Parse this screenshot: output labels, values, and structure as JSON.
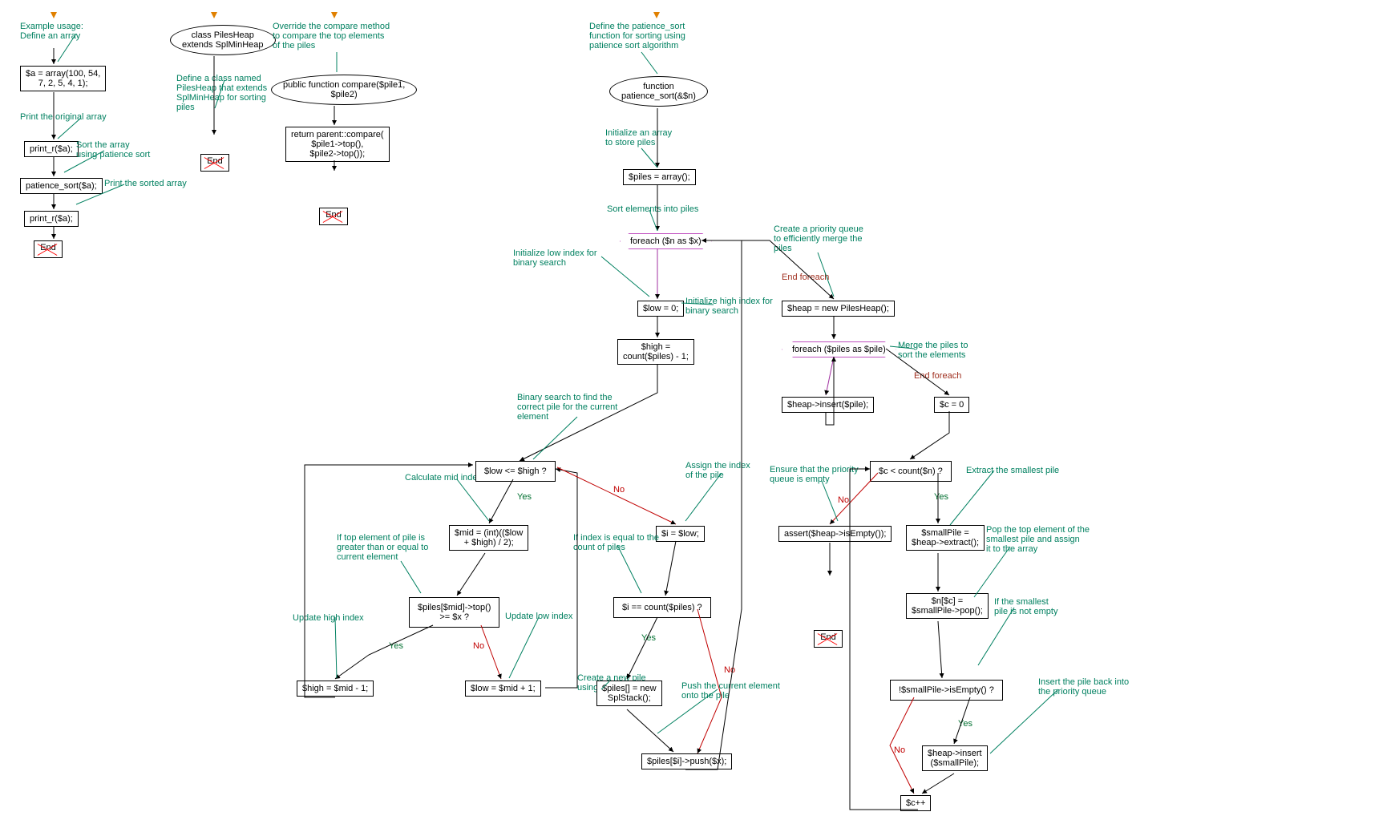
{
  "col1": {
    "ann1": "Example usage:\nDefine an array",
    "n1": "$a = array(100, 54,\n7, 2, 5, 4, 1);",
    "ann2": "Print the original array",
    "n2": "print_r($a);",
    "ann3": "Sort the array\nusing patience sort",
    "n3": "patience_sort($a);",
    "ann4": "Print the sorted array",
    "n4": "print_r($a);",
    "end": "End"
  },
  "col2": {
    "n1": "class PilesHeap\nextends SplMinHeap",
    "ann1": "Define a class named\nPilesHeap that extends\nSplMinHeap for sorting\npiles",
    "end": "End"
  },
  "col3": {
    "ann1": "Override the compare method\nto compare the top elements\nof the piles",
    "n1": "public function compare($pile1,\n$pile2)",
    "n2": "return parent::compare(\n$pile1->top(),\n$pile2->top());",
    "end": "End"
  },
  "main": {
    "ann_top": "Define the patience_sort\nfunction for sorting using\npatience sort algorithm",
    "fn": "function\npatience_sort(&$n)",
    "ann_init": "Initialize an array\nto store piles",
    "piles": "$piles = array();",
    "ann_sort": "Sort elements into piles",
    "foreach1": "foreach ($n as $x)",
    "ann_low": "Initialize low index for\nbinary search",
    "low": "$low = 0;",
    "ann_high": "Initialize high index for\nbinary search",
    "high": "$high =\ncount($piles) - 1;",
    "ann_bin": "Binary search to find the\ncorrect pile for the current\nelement",
    "cond_lowhigh": "$low <= $high ?",
    "ann_calcmid": "Calculate mid index",
    "mid": "$mid = (int)(($low\n+ $high) / 2);",
    "ann_iftop": "If top element of pile is\ngreater than or equal to\ncurrent element",
    "cond_top": "$piles[$mid]->top()\n>= $x ?",
    "ann_uphigh": "Update high index",
    "sethigh": "$high = $mid - 1;",
    "ann_uplow": "Update low index",
    "setlow": "$low = $mid + 1;",
    "ann_assignidx": "Assign the index\nof the pile",
    "ilow": "$i = $low;",
    "ann_ifidx": "If index is equal to the\ncount of piles",
    "cond_i": "$i == count($piles) ?",
    "ann_newpile": "Create a new pile\nusing SplStack",
    "newstack": "$piles[] = new\nSplStack();",
    "ann_push": "Push the current element\nonto the pile",
    "push": "$piles[$i]->push($x);",
    "ann_heap": "Create a priority queue\nto efficiently merge the\npiles",
    "endforeach1": "End foreach",
    "heap": "$heap = new PilesHeap();",
    "foreach2": "foreach ($piles as $pile)",
    "ann_merge": "Merge the piles to\nsort the elements",
    "endforeach2": "End foreach",
    "insert": "$heap->insert($pile);",
    "czero": "$c = 0",
    "cond_c": "$c < count($n) ?",
    "ann_ensure": "Ensure that the priority\nqueue is empty",
    "assert": "assert($heap->isEmpty());",
    "end": "End",
    "ann_extract": "Extract the smallest pile",
    "extract": "$smallPile =\n$heap->extract();",
    "ann_pop": "Pop the top element of the\nsmallest pile and assign\nit to the array",
    "pop": "$n[$c] =\n$smallPile->pop();",
    "ann_ifempty": "If the smallest\npile is not empty",
    "cond_empty": "!$smallPile->isEmpty() ?",
    "ann_insertback": "Insert the pile back into\nthe priority queue",
    "insertsmall": "$heap->insert\n($smallPile);",
    "cpp": "$c++"
  },
  "labels": {
    "yes": "Yes",
    "no": "No"
  }
}
